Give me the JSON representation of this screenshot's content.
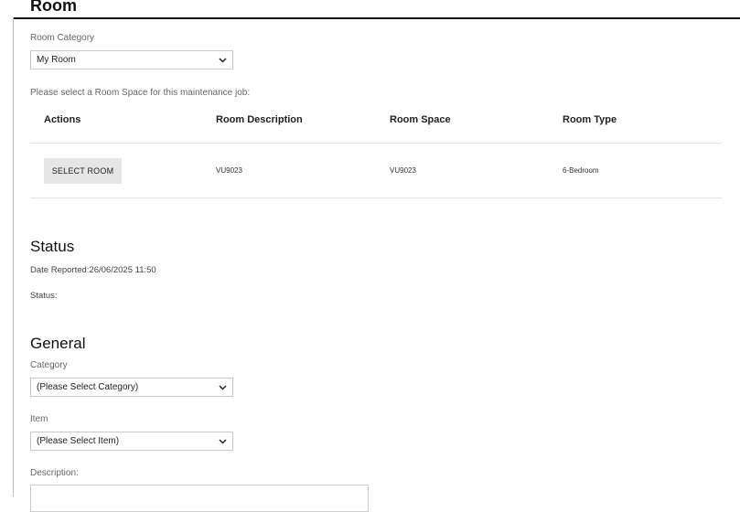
{
  "room": {
    "heading": "Room",
    "category_label": "Room Category",
    "category_value": "My Room",
    "prompt": "Please select a Room Space for this maintenance job:",
    "table": {
      "headers": [
        "Actions",
        "Room Description",
        "Room Space",
        "Room Type"
      ],
      "rows": [
        {
          "action": "SELECT ROOM",
          "description": "VU9023",
          "space": "VU9023",
          "type": "6-Bedroom"
        }
      ]
    }
  },
  "status": {
    "title": "Status",
    "date_reported": "Date Reported:26/06/2025 11:50",
    "status_label": "Status:"
  },
  "general": {
    "title": "General",
    "category_label": "Category",
    "category_value": "(Please Select Category)",
    "item_label": "Item",
    "item_value": "(Please Select Item)",
    "description_label": "Description:"
  },
  "icons": {
    "dropdown": "chevron-down-icon"
  }
}
